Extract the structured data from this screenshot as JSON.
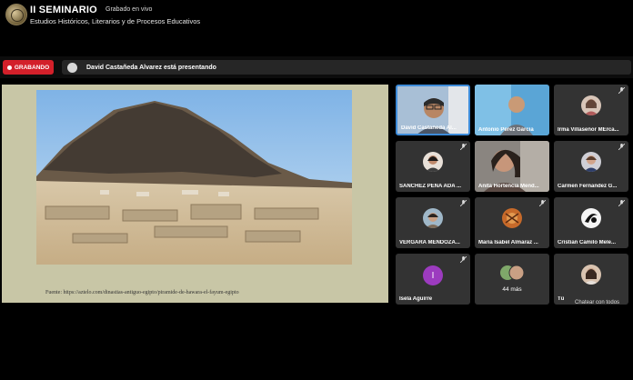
{
  "app": {
    "title": "II SEMINARIO",
    "recording_status": "Grabado en vivo",
    "subtitle": "Estudios Históricos, Literarios y de Procesos Educativos"
  },
  "toolbar": {
    "recording_label": "GRABANDO",
    "presenter_message": "David Castañeda Alvarez está presentando",
    "recording_color": "#d3202a"
  },
  "slide": {
    "caption": "Fuente: https://aztelo.com/dinastias-antiguo-egipto/piramide-de-hawara-el-fayum-egipto"
  },
  "participants": [
    {
      "name": "David Castañeda Al...",
      "active": true
    },
    {
      "name": "Antonio Pérez García"
    },
    {
      "name": "Irma Villaseñor MErca..."
    },
    {
      "name": "SANCHEZ PEÑA ADA ..."
    },
    {
      "name": "Anita Hortencia Mend..."
    },
    {
      "name": "Carmen Fernandez G..."
    },
    {
      "name": "VERGARA MENDOZA..."
    },
    {
      "name": "Maria Isabel Almaraz ..."
    },
    {
      "name": "Cristian Camilo Mele..."
    },
    {
      "name": "Isela Aguirre",
      "initial": "I"
    },
    {
      "more": "44 más"
    },
    {
      "name": "Tú"
    }
  ],
  "footer": {
    "chat_label": "Chatear con todos"
  },
  "colors": {
    "accent_border": "#3d8bd9",
    "initial_avatar": "#9c3bbf"
  }
}
